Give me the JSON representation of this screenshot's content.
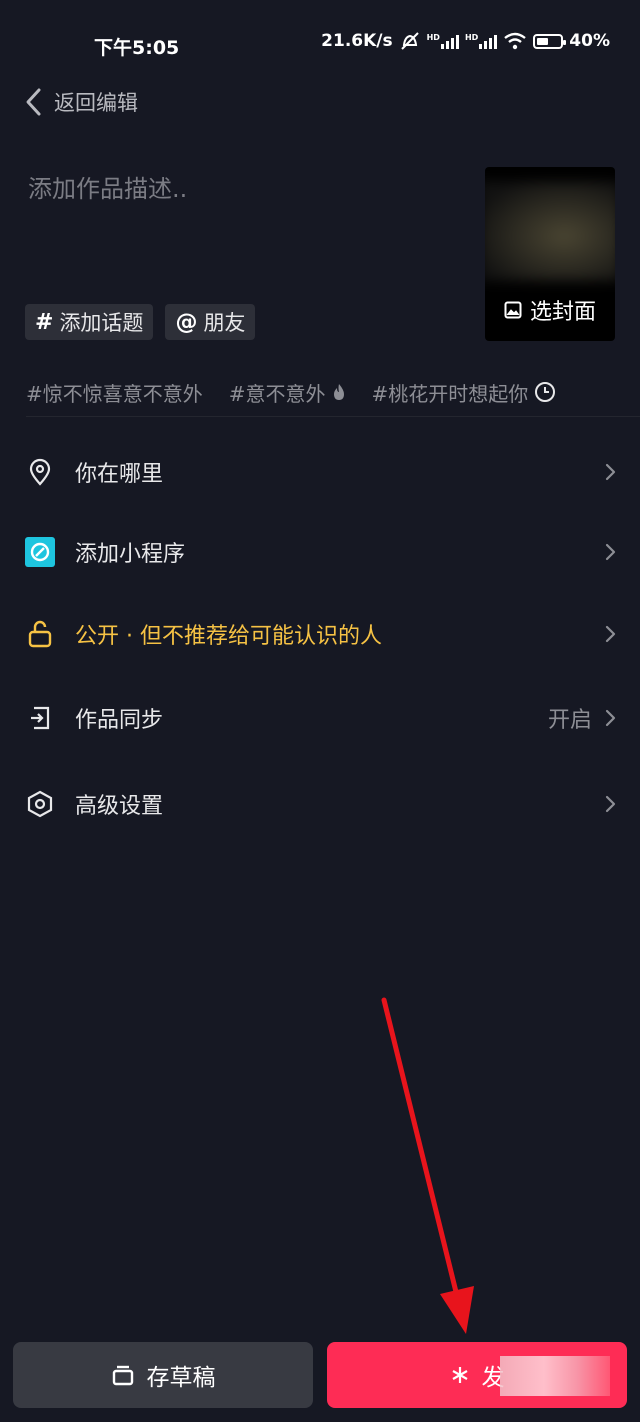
{
  "status": {
    "time": "下午5:05",
    "net_speed": "21.6K/s",
    "hd1": "HD",
    "hd2": "HD",
    "battery": "40%"
  },
  "nav": {
    "back_label": "返回编辑"
  },
  "description": {
    "placeholder": "添加作品描述.."
  },
  "cover": {
    "label": "选封面"
  },
  "chips": [
    {
      "symbol": "#",
      "label": "添加话题"
    },
    {
      "symbol": "@",
      "label": "朋友"
    }
  ],
  "trends": [
    "#惊不惊喜意不意外",
    "#意不意外",
    "#桃花开时想起你"
  ],
  "menu": [
    {
      "label": "你在哪里",
      "icon": "location-pin-icon",
      "value": ""
    },
    {
      "label": "添加小程序",
      "icon": "mini-program-icon",
      "value": ""
    },
    {
      "label": "公开 · 但不推荐给可能认识的人",
      "icon": "unlock-icon",
      "value": ""
    },
    {
      "label": "作品同步",
      "icon": "sync-exit-icon",
      "value": "开启"
    },
    {
      "label": "高级设置",
      "icon": "hexagon-settings-icon",
      "value": ""
    }
  ],
  "actions": {
    "draft_label": "存草稿",
    "publish_label": "发"
  },
  "colors": {
    "background": "#161823",
    "accent": "#fe2c55",
    "privacy": "#f6c244",
    "mini_program": "#1ec5df"
  }
}
